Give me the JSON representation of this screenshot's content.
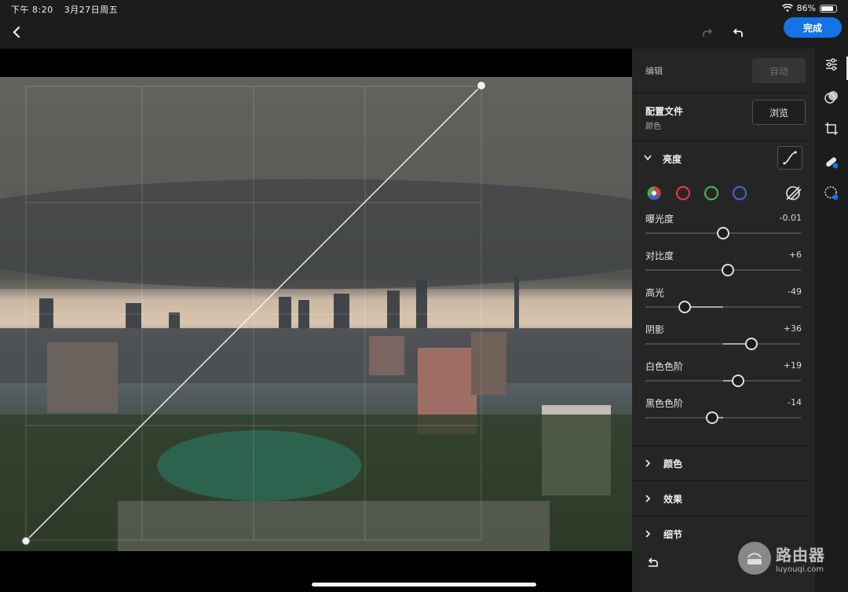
{
  "status_bar": {
    "time": "下午 8:20",
    "date": "3月27日周五",
    "battery": "86%",
    "battery_level": 0.86
  },
  "nav": {
    "done_label": "完成"
  },
  "panel": {
    "edit_label": "编辑",
    "auto_label": "自动",
    "profile_title": "配置文件",
    "profile_sub": "颜色",
    "browse_label": "浏览",
    "light_section": "亮度",
    "sliders": [
      {
        "label": "曝光度",
        "value": "-0.01",
        "level": 0.0
      },
      {
        "label": "对比度",
        "value": "+6",
        "level": 0.06
      },
      {
        "label": "高光",
        "value": "-49",
        "level": -0.49
      },
      {
        "label": "阴影",
        "value": "+36",
        "level": 0.36
      },
      {
        "label": "白色色阶",
        "value": "+19",
        "level": 0.19
      },
      {
        "label": "黑色色阶",
        "value": "-14",
        "level": -0.14
      }
    ],
    "collapsed_sections": [
      "颜色",
      "效果",
      "细节"
    ]
  },
  "channel_colors": {
    "red": "#e03a3a",
    "green": "#45b04a",
    "blue": "#3f63d1",
    "accent": "#1473e6"
  },
  "watermark": {
    "cn": "路由器",
    "en": "luyouqi.com"
  }
}
